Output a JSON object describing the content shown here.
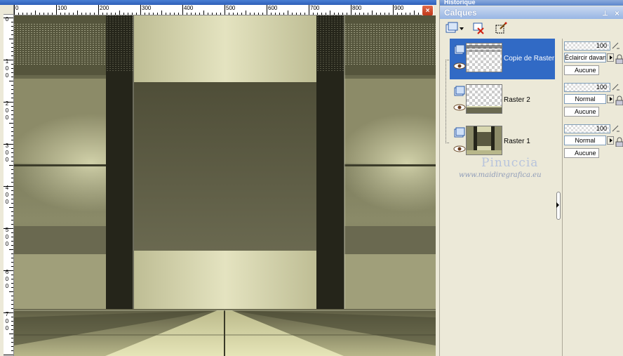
{
  "canvas": {
    "ruler_h_labels": [
      "0",
      "100",
      "200",
      "300",
      "400",
      "500",
      "600",
      "700",
      "800",
      "900"
    ],
    "ruler_v_labels": [
      "0",
      "100",
      "200",
      "300",
      "400",
      "500",
      "600",
      "700"
    ],
    "close_glyph": "×"
  },
  "panel": {
    "history_title": "Historique",
    "title": "Calques",
    "pin_glyph": "⊥",
    "close_glyph": "×",
    "toolbar": [
      {
        "name": "new-layer-icon"
      },
      {
        "name": "delete-layer-icon"
      },
      {
        "name": "edit-selection-icon"
      }
    ],
    "layers": [
      {
        "name": "Copie de Raster 2",
        "opacity": "100",
        "blend": "Éclaircir davantage",
        "mask": "Aucune",
        "selected": true
      },
      {
        "name": "Raster 2",
        "opacity": "100",
        "blend": "Normal",
        "mask": "Aucune",
        "selected": false
      },
      {
        "name": "Raster 1",
        "opacity": "100",
        "blend": "Normal",
        "mask": "Aucune",
        "selected": false
      }
    ]
  },
  "watermark": {
    "name": "Pinuccia",
    "url": "www.maidiregrafica.eu"
  },
  "colors": {
    "selection": "#316ac5",
    "title_bar": "#98b6e4",
    "panel_bg": "#ece9d8"
  }
}
